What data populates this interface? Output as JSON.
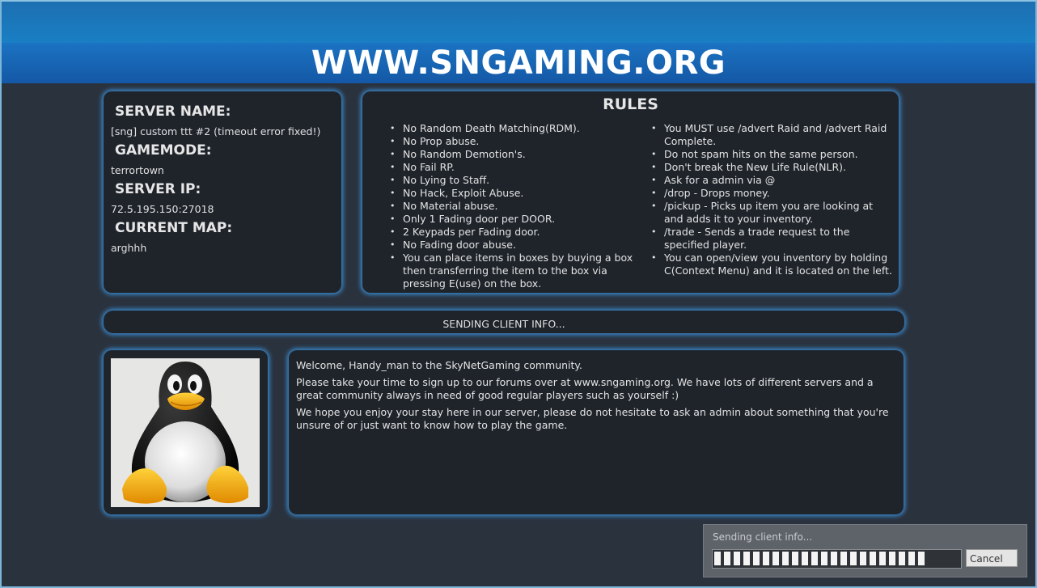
{
  "header": {
    "site_title": "WWW.SNGAMING.ORG"
  },
  "server_info": {
    "server_name_label": "SERVER NAME:",
    "server_name": "[sng] custom ttt #2 (timeout error fixed!)",
    "gamemode_label": "GAMEMODE:",
    "gamemode": "terrortown",
    "server_ip_label": "SERVER IP:",
    "server_ip": "72.5.195.150:27018",
    "current_map_label": "CURRENT MAP:",
    "current_map": "arghhh"
  },
  "rules": {
    "title": "RULES",
    "left": [
      "No Random Death Matching(RDM).",
      "No Prop abuse.",
      "No Random Demotion's.",
      "No Fail RP.",
      "No Lying to Staff.",
      "No Hack, Exploit Abuse.",
      "No Material abuse.",
      "Only 1 Fading door per DOOR.",
      "2 Keypads per Fading door.",
      "No Fading door abuse.",
      "You can place items in boxes by buying a box then transferring the item to the box via pressing E(use) on the box."
    ],
    "right": [
      "You MUST use /advert Raid and /advert Raid Complete.",
      "Do not spam hits on the same person.",
      "Don't break the New Life Rule(NLR).",
      "Ask for a admin via @",
      "/drop - Drops money.",
      "/pickup - Picks up item you are looking at and adds it to your inventory.",
      "/trade - Sends a trade request to the specified player.",
      "You can open/view you inventory by holding C(Context Menu) and it is located on the left."
    ]
  },
  "status": {
    "text": "SENDING CLIENT INFO..."
  },
  "avatar": {
    "icon": "penguin-avatar"
  },
  "welcome": {
    "line1": "Welcome, Handy_man to the SkyNetGaming community.",
    "line2": "Please take your time to sign up to our forums over at www.sngaming.org. We have lots of different servers and a great community always in need of good regular players such as yourself :)",
    "line3": "We hope you enjoy your stay here in our server, please do not hesitate to ask an admin about something that you're unsure of or just want to know how to play the game."
  },
  "loading_dialog": {
    "label": "Sending client info...",
    "progress": 0.86,
    "cancel_label": "Cancel"
  },
  "colors": {
    "accent": "#1b73c2",
    "panel": "#1f242b",
    "glow": "#3b8fd8",
    "background": "#2a323d"
  }
}
